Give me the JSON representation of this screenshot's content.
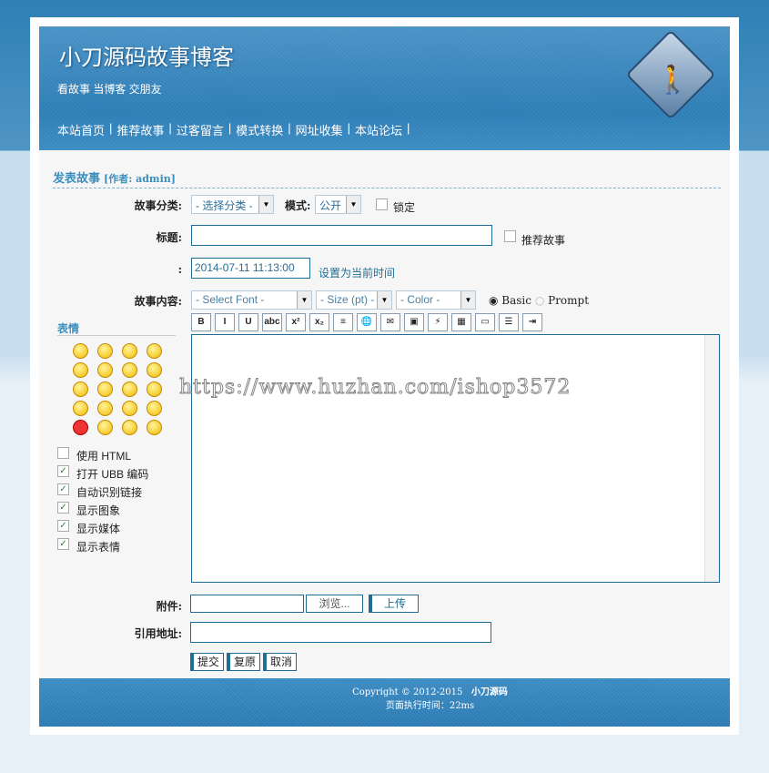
{
  "header": {
    "title": "小刀源码故事博客",
    "slogan": "看故事 当博客 交朋友",
    "nav": [
      "本站首页",
      "推荐故事",
      "过客留言",
      "模式转换",
      "网址收集",
      "本站论坛"
    ],
    "logo": "pedestrian-crossing-sign"
  },
  "form": {
    "section_title": "发表故事",
    "author": "[作者: admin]",
    "category_label": "故事分类:",
    "category_value": "- 选择分类 -",
    "mode_label": "模式:",
    "mode_value": "公开",
    "lock_label": "锁定",
    "title_label": "标题:",
    "title_value": "",
    "recommend_label": "推荐故事",
    "time_label": ":",
    "time_value": "2014-07-11 11:13:00",
    "set_now_link": "设置为当前时间",
    "content_label": "故事内容:",
    "font_select": "- Select Font -",
    "size_select": "- Size (pt) -",
    "color_select": "- Color -",
    "mode_basic": "Basic",
    "mode_prompt": "Prompt",
    "toolbar": [
      "bold",
      "italic",
      "underline",
      "strikethrough",
      "superscript",
      "subscript",
      "center",
      "link",
      "email",
      "image",
      "flash",
      "media",
      "quote",
      "ordered-list",
      "indent"
    ],
    "toolbar_glyphs": [
      "B",
      "I",
      "U",
      "abc",
      "x²",
      "x₂",
      "≡",
      "🌐",
      "✉",
      "▣",
      "⚡",
      "▦",
      "▭",
      "☰",
      "⇥"
    ],
    "emotion_title": "表情",
    "options": [
      {
        "label": "使用  HTML",
        "checked": false
      },
      {
        "label": "打开  UBB 编码",
        "checked": true
      },
      {
        "label": "自动识别链接",
        "checked": true
      },
      {
        "label": "显示图象",
        "checked": true
      },
      {
        "label": "显示媒体",
        "checked": true
      },
      {
        "label": "显示表情",
        "checked": true
      }
    ],
    "attachment_label": "附件:",
    "browse_button": "浏览...",
    "upload_button": "上传",
    "ref_label": "引用地址:",
    "ref_value": "",
    "submit_button": "提交",
    "reset_button": "复原",
    "cancel_button": "取消"
  },
  "footer": {
    "copyright": "Copyright © 2012-2015",
    "brand": "小刀源码",
    "exec_time": "页面执行时间：22ms"
  },
  "watermark": "https://www.huzhan.com/ishop3572"
}
